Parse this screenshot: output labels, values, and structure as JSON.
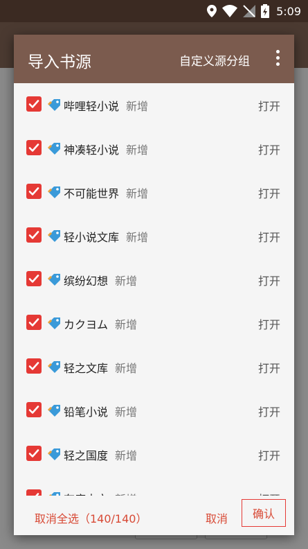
{
  "status": {
    "time": "5:09"
  },
  "dialog": {
    "title": "导入书源",
    "group_label": "自定义源分组",
    "items": [
      {
        "name": "哔哩轻小说",
        "state": "新增",
        "action": "打开"
      },
      {
        "name": "神凑轻小说",
        "state": "新增",
        "action": "打开"
      },
      {
        "name": "不可能世界",
        "state": "新增",
        "action": "打开"
      },
      {
        "name": "轻小说文库",
        "state": "新增",
        "action": "打开"
      },
      {
        "name": "缤纷幻想",
        "state": "新增",
        "action": "打开"
      },
      {
        "name": "カクヨム",
        "state": "新增",
        "action": "打开"
      },
      {
        "name": "轻之文库",
        "state": "新增",
        "action": "打开"
      },
      {
        "name": "铅笔小说",
        "state": "新增",
        "action": "打开"
      },
      {
        "name": "轻之国度",
        "state": "新增",
        "action": "打开"
      },
      {
        "name": "有度中文",
        "state": "新增",
        "action": "打开"
      }
    ],
    "footer": {
      "select_all": "取消全选（140/140）",
      "cancel": "取消",
      "confirm": "确认"
    }
  },
  "colors": {
    "accent": "#e53935",
    "header": "#7b5b4e",
    "statusbar": "#3b2a22"
  },
  "icons": {
    "checkbox": "checkbox-checked-icon",
    "tag": "tag-icon",
    "more": "more-vertical-icon"
  }
}
